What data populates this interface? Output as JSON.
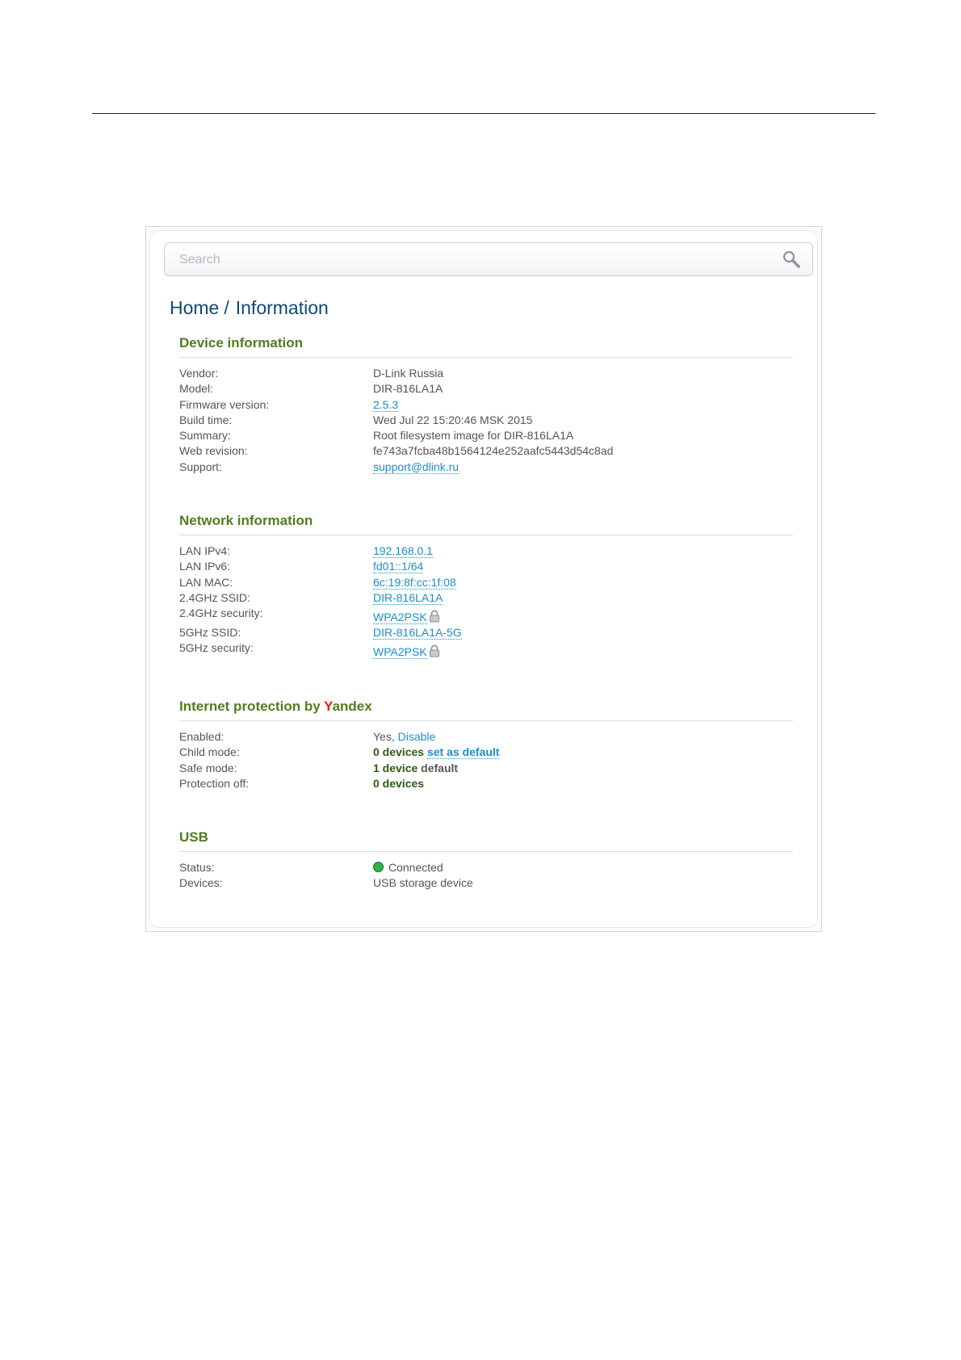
{
  "search": {
    "placeholder": "Search"
  },
  "breadcrumb": {
    "home": "Home",
    "separator": "/",
    "current": "Information"
  },
  "device_info": {
    "title": "Device information",
    "rows": [
      {
        "label": "Vendor:",
        "value": "D-Link Russia"
      },
      {
        "label": "Model:",
        "value": "DIR-816LA1A"
      },
      {
        "label": "Firmware version:",
        "value": "2.5.3"
      },
      {
        "label": "Build time:",
        "value": "Wed Jul 22 15:20:46 MSK 2015"
      },
      {
        "label": "Summary:",
        "value": "Root filesystem image for DIR-816LA1A"
      },
      {
        "label": "Web revision:",
        "value": "fe743a7fcba48b1564124e252aafc5443d54c8ad"
      },
      {
        "label": "Support:",
        "value": "support@dlink.ru"
      }
    ]
  },
  "network_info": {
    "title": "Network information",
    "rows": [
      {
        "label": "LAN IPv4:",
        "value": "192.168.0.1"
      },
      {
        "label": "LAN IPv6:",
        "value": "fd01::1/64"
      },
      {
        "label": "LAN MAC:",
        "value": "6c:19:8f:cc:1f:08"
      },
      {
        "label": "2.4GHz SSID:",
        "value": "DIR-816LA1A"
      },
      {
        "label": "2.4GHz security:",
        "value": "WPA2PSK"
      },
      {
        "label": "5GHz SSID:",
        "value": "DIR-816LA1A-5G"
      },
      {
        "label": "5GHz security:",
        "value": "WPA2PSK"
      }
    ]
  },
  "yandex": {
    "title_prefix": "Internet protection by ",
    "title_brand_first": "Y",
    "title_brand_rest": "andex",
    "enabled_label": "Enabled:",
    "enabled_value": "Yes,",
    "enabled_action": "Disable",
    "child_label": "Child mode:",
    "child_count": "0 devices",
    "child_action": "set as default",
    "safe_label": "Safe mode:",
    "safe_count": "1 device",
    "safe_default": "default",
    "off_label": "Protection off:",
    "off_count": "0 devices"
  },
  "usb": {
    "title": "USB",
    "status_label": "Status:",
    "status_value": "Connected",
    "devices_label": "Devices:",
    "devices_value": "USB storage device"
  },
  "colors": {
    "heading_green": "#4f7d1f",
    "breadcrumb_blue": "#0e4a73",
    "link_blue": "#1b8ec9",
    "yandex_red": "#e2231a",
    "status_green": "#2fb24a"
  }
}
